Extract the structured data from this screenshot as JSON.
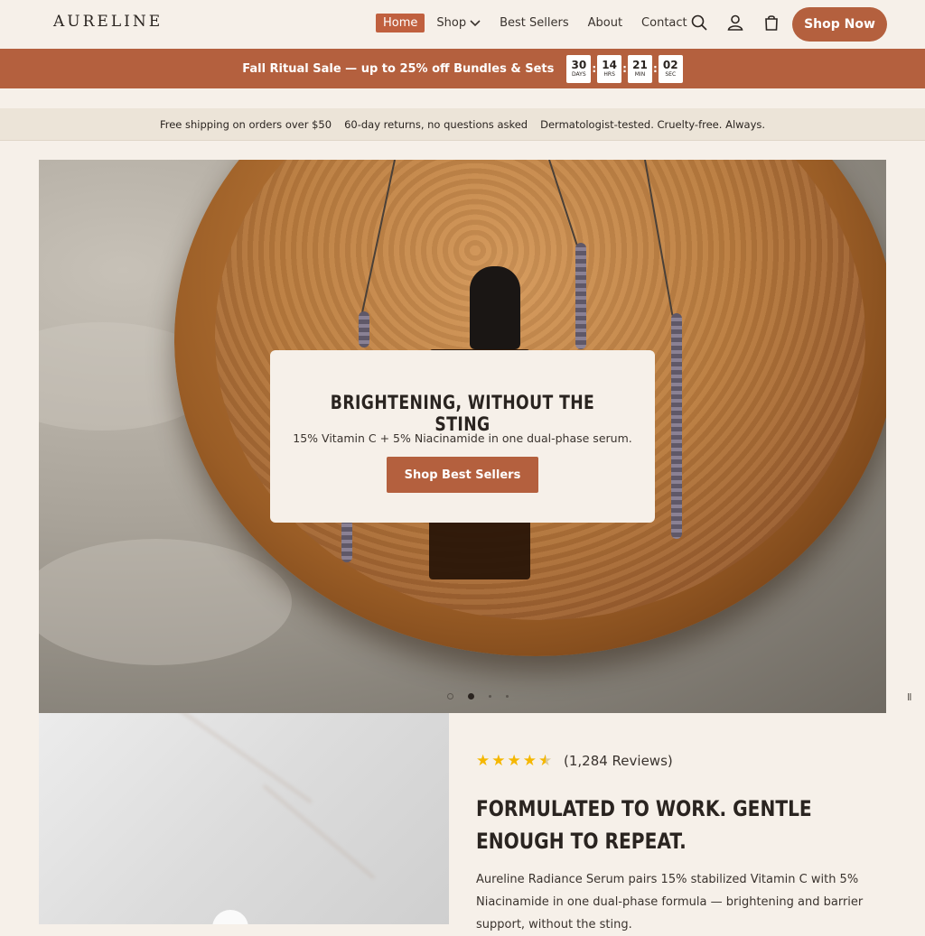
{
  "brand": {
    "logo": "AURELINE"
  },
  "nav": {
    "items": [
      {
        "label": "Home",
        "active": true
      },
      {
        "label": "Shop",
        "has_dropdown": true
      },
      {
        "label": "Best Sellers"
      },
      {
        "label": "About"
      },
      {
        "label": "Contact"
      }
    ],
    "icons": [
      "search-icon",
      "account-icon",
      "cart-icon"
    ],
    "cta_label": "Shop Now"
  },
  "sale_bar": {
    "text": "Fall Ritual Sale — up to 25% off Bundles & Sets",
    "countdown": [
      {
        "value": "30",
        "unit": "DAYS"
      },
      {
        "value": "14",
        "unit": "HRS"
      },
      {
        "value": "21",
        "unit": "MIN"
      },
      {
        "value": "02",
        "unit": "SEC"
      }
    ]
  },
  "info_bar": {
    "items": [
      "Free shipping on orders over $50",
      "60-day returns, no questions asked",
      "Dermatologist-tested. Cruelty-free. Always."
    ]
  },
  "hero": {
    "title": "BRIGHTENING, WITHOUT THE STING",
    "subtitle": "15% Vitamin C + 5% Niacinamide in one dual-phase serum.",
    "button_label": "Shop Best Sellers",
    "slide_active_index": 1,
    "pause_label": "II"
  },
  "product": {
    "rating": 4.5,
    "reviews_label": "(1,284 Reviews)",
    "title": "FORMULATED TO WORK. GENTLE ENOUGH TO REPEAT.",
    "description": "Aureline Radiance Serum pairs 15% stabilized Vitamin C with 5% Niacinamide in one dual-phase formula — brightening and barrier support, without the sting."
  },
  "colors": {
    "accent": "#b4603e",
    "background": "#f6f0e9",
    "info_bar": "#ece4d8",
    "star": "#f5b700"
  }
}
